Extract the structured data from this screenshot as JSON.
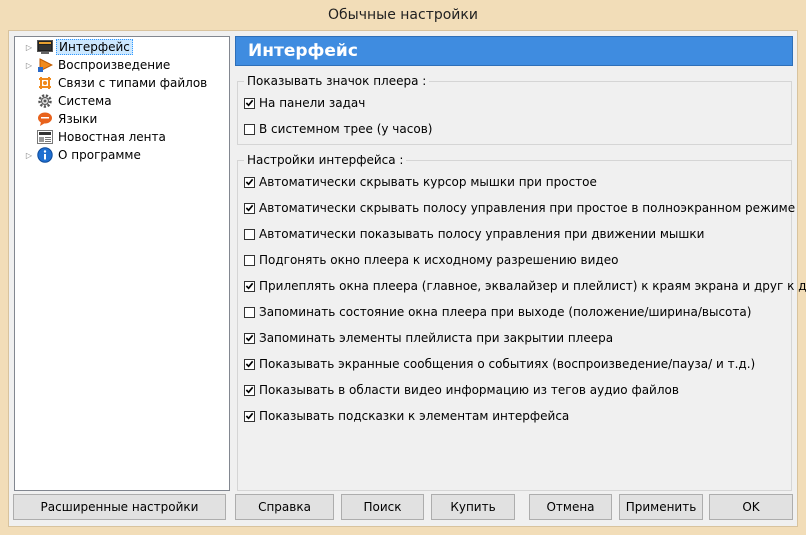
{
  "window": {
    "title": "Обычные настройки"
  },
  "tree": [
    {
      "label": "Интерфейс",
      "icon": "monitor-icon",
      "expandable": true,
      "selected": true
    },
    {
      "label": "Воспроизведение",
      "icon": "play-icon",
      "expandable": true
    },
    {
      "label": "Связи с типами файлов",
      "icon": "file-association-icon",
      "expandable": false
    },
    {
      "label": "Система",
      "icon": "gear-icon",
      "expandable": false
    },
    {
      "label": "Языки",
      "icon": "language-icon",
      "expandable": false
    },
    {
      "label": "Новостная лента",
      "icon": "news-icon",
      "expandable": false
    },
    {
      "label": "О программе",
      "icon": "info-icon",
      "expandable": true
    }
  ],
  "panel": {
    "title": "Интерфейс"
  },
  "group1": {
    "title": "Показывать значок плеера :",
    "options": [
      {
        "label": "На панели задач",
        "checked": true
      },
      {
        "label": "В системном трее (у часов)",
        "checked": false
      }
    ]
  },
  "group2": {
    "title": "Настройки интерфейса :",
    "options": [
      {
        "label": "Автоматически скрывать курсор мышки при простое",
        "checked": true
      },
      {
        "label": "Автоматически скрывать полосу управления при простое в полноэкранном режиме",
        "checked": true
      },
      {
        "label": "Автоматически показывать полосу управления при движении мышки",
        "checked": false
      },
      {
        "label": "Подгонять окно плеера к исходному разрешению видео",
        "checked": false
      },
      {
        "label": "Прилеплять окна плеера (главное, эквалайзер и плейлист) к краям экрана и друг к другу",
        "checked": true
      },
      {
        "label": "Запоминать состояние окна плеера при выходе (положение/ширина/высота)",
        "checked": false
      },
      {
        "label": "Запоминать элементы плейлиста при закрытии плеера",
        "checked": true
      },
      {
        "label": "Показывать экранные сообщения о событиях (воспроизведение/пауза/ и т.д.)",
        "checked": true
      },
      {
        "label": "Показывать в области видео информацию из тегов аудио файлов",
        "checked": true
      },
      {
        "label": "Показывать подсказки к элементам интерфейса",
        "checked": true
      }
    ]
  },
  "buttons": {
    "advanced": "Расширенные настройки",
    "help": "Справка",
    "search": "Поиск",
    "buy": "Купить",
    "cancel": "Отмена",
    "apply": "Применить",
    "ok": "OK"
  },
  "colors": {
    "header_bg": "#3f8ce0",
    "frame": "#f2ddb8",
    "selection": "#cce8ff"
  }
}
